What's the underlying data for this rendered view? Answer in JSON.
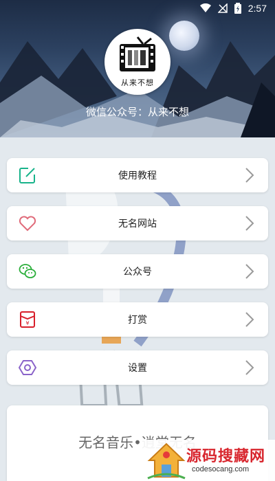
{
  "status_bar": {
    "time": "2:57"
  },
  "header": {
    "avatar_caption": "从来不想",
    "subtitle": "微信公众号：从来不想"
  },
  "menu": [
    {
      "label": "使用教程",
      "icon": "edit-icon",
      "color": "#17b38a"
    },
    {
      "label": "无名网站",
      "icon": "heart-icon",
      "color": "#e06b7a"
    },
    {
      "label": "公众号",
      "icon": "wechat-icon",
      "color": "#2aae3a"
    },
    {
      "label": "打赏",
      "icon": "red-envelope-icon",
      "color": "#d81e2a"
    },
    {
      "label": "设置",
      "icon": "settings-icon",
      "color": "#8a63c9"
    }
  ],
  "footer": {
    "text": "无名音乐•逍堂无名"
  },
  "watermark": {
    "title": "源码搜藏网",
    "url": "codesocang.com"
  }
}
